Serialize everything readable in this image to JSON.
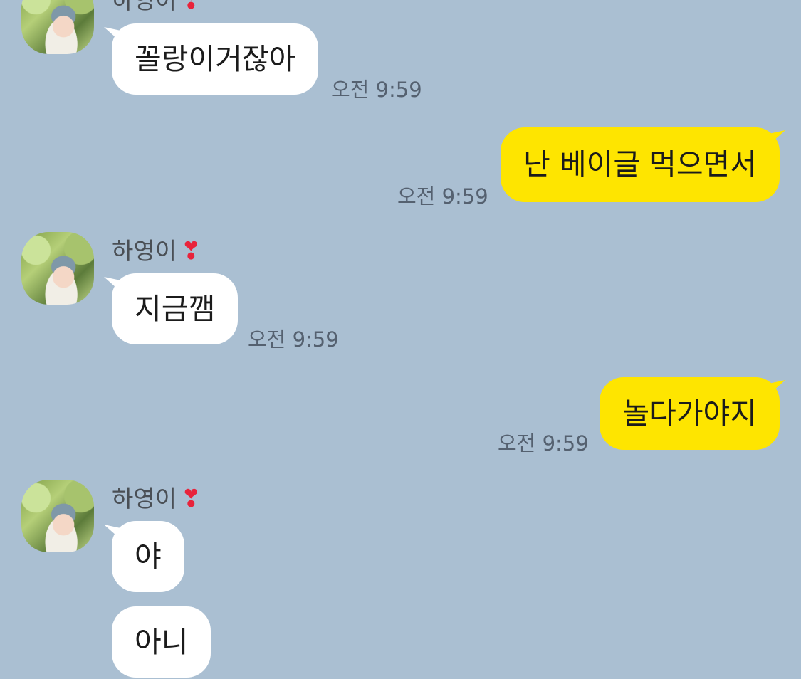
{
  "messages": [
    {
      "type": "in",
      "sender": "하영이",
      "heart": "❣",
      "text": "꼴랑이거잖아",
      "time": "오전 9:59"
    },
    {
      "type": "out",
      "text": "난 베이글 먹으면서",
      "time": "오전 9:59"
    },
    {
      "type": "in",
      "sender": "하영이",
      "heart": "❣",
      "text": "지금깸",
      "time": "오전 9:59"
    },
    {
      "type": "out",
      "text": "놀다가야지",
      "time": "오전 9:59"
    },
    {
      "type": "in",
      "sender": "하영이",
      "heart": "❣",
      "text": "야"
    },
    {
      "type": "in",
      "text": "아니"
    }
  ],
  "colors": {
    "background": "#aabfd2",
    "incoming": "#ffffff",
    "outgoing": "#fee500",
    "heart": "#e8233b"
  },
  "icons": {
    "avatar": "profile-photo",
    "heart": "heart-exclamation-icon"
  }
}
